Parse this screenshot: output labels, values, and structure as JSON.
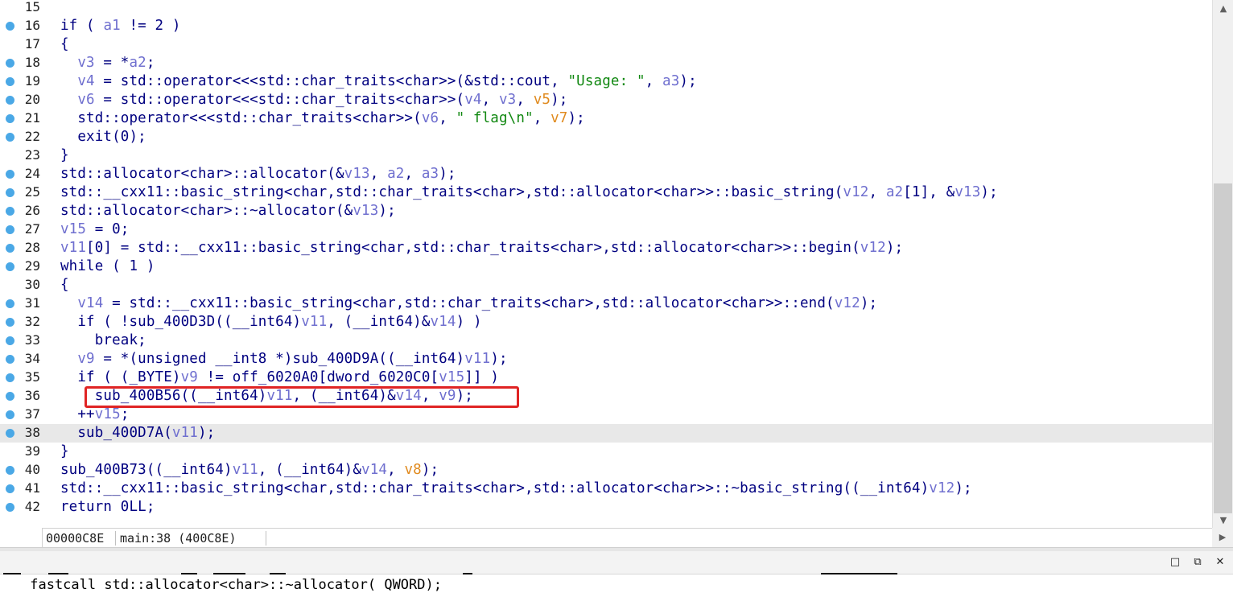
{
  "editor": {
    "lines": [
      {
        "num": "15",
        "bp": false,
        "html": ""
      },
      {
        "num": "16",
        "bp": true,
        "html": "if ( <span class=\"v\">a1</span> != 2 )"
      },
      {
        "num": "17",
        "bp": false,
        "html": "{"
      },
      {
        "num": "18",
        "bp": true,
        "html": "  <span class=\"v\">v3</span> = *<span class=\"v\">a2</span>;"
      },
      {
        "num": "19",
        "bp": true,
        "html": "  <span class=\"v\">v4</span> = std::operator&lt;&lt;&lt;std::char_traits&lt;char&gt;&gt;(&amp;std::cout, <span class=\"s\">\"Usage: \"</span>, <span class=\"v\">a3</span>);"
      },
      {
        "num": "20",
        "bp": true,
        "html": "  <span class=\"v\">v6</span> = std::operator&lt;&lt;&lt;std::char_traits&lt;char&gt;&gt;(<span class=\"v\">v4</span>, <span class=\"v\">v3</span>, <span class=\"o\">v5</span>);"
      },
      {
        "num": "21",
        "bp": true,
        "html": "  std::operator&lt;&lt;&lt;std::char_traits&lt;char&gt;&gt;(<span class=\"v\">v6</span>, <span class=\"s\">\" flag\\n\"</span>, <span class=\"o\">v7</span>);"
      },
      {
        "num": "22",
        "bp": true,
        "html": "  exit(0);"
      },
      {
        "num": "23",
        "bp": false,
        "html": "}"
      },
      {
        "num": "24",
        "bp": true,
        "html": "std::allocator&lt;char&gt;::allocator(&amp;<span class=\"v\">v13</span>, <span class=\"v\">a2</span>, <span class=\"v\">a3</span>);"
      },
      {
        "num": "25",
        "bp": true,
        "html": "std::__cxx11::basic_string&lt;char,std::char_traits&lt;char&gt;,std::allocator&lt;char&gt;&gt;::basic_string(<span class=\"v\">v12</span>, <span class=\"v\">a2</span>[1], &amp;<span class=\"v\">v13</span>);"
      },
      {
        "num": "26",
        "bp": true,
        "html": "std::allocator&lt;char&gt;::~allocator(&amp;<span class=\"v\">v13</span>);"
      },
      {
        "num": "27",
        "bp": true,
        "html": "<span class=\"v\">v15</span> = 0;"
      },
      {
        "num": "28",
        "bp": true,
        "html": "<span class=\"v\">v11</span>[0] = std::__cxx11::basic_string&lt;char,std::char_traits&lt;char&gt;,std::allocator&lt;char&gt;&gt;::begin(<span class=\"v\">v12</span>);"
      },
      {
        "num": "29",
        "bp": true,
        "html": "while ( 1 )"
      },
      {
        "num": "30",
        "bp": false,
        "html": "{"
      },
      {
        "num": "31",
        "bp": true,
        "html": "  <span class=\"v\">v14</span> = std::__cxx11::basic_string&lt;char,std::char_traits&lt;char&gt;,std::allocator&lt;char&gt;&gt;::end(<span class=\"v\">v12</span>);"
      },
      {
        "num": "32",
        "bp": true,
        "html": "  if ( !sub_400D3D((__int64)<span class=\"v\">v11</span>, (__int64)&amp;<span class=\"v\">v14</span>) )"
      },
      {
        "num": "33",
        "bp": true,
        "html": "    break;"
      },
      {
        "num": "34",
        "bp": true,
        "html": "  <span class=\"v\">v9</span> = *(unsigned __int8 *)sub_400D9A((__int64)<span class=\"v\">v11</span>);"
      },
      {
        "num": "35",
        "bp": true,
        "html": "  if ( (_BYTE)<span class=\"v\">v9</span> != off_6020A0[dword_6020C0[<span class=\"v\">v15</span>]] )"
      },
      {
        "num": "36",
        "bp": true,
        "html": "    sub_400B56((__int64)<span class=\"v\">v11</span>, (__int64)&amp;<span class=\"v\">v14</span>, <span class=\"v\">v9</span>);"
      },
      {
        "num": "37",
        "bp": true,
        "html": "  ++<span class=\"v\">v15</span>;"
      },
      {
        "num": "38",
        "bp": true,
        "html": "  sub_400D7A(<span class=\"v\">v11</span>);"
      },
      {
        "num": "39",
        "bp": false,
        "html": "}"
      },
      {
        "num": "40",
        "bp": true,
        "html": "sub_400B73((__int64)<span class=\"v\">v11</span>, (__int64)&amp;<span class=\"v\">v14</span>, <span class=\"o\">v8</span>);"
      },
      {
        "num": "41",
        "bp": true,
        "html": "std::__cxx11::basic_string&lt;char,std::char_traits&lt;char&gt;,std::allocator&lt;char&gt;&gt;::~basic_string((__int64)<span class=\"v\">v12</span>);"
      },
      {
        "num": "42",
        "bp": true,
        "html": "return 0LL;"
      }
    ],
    "current_line": "38",
    "highlighted_line": "36"
  },
  "status": {
    "address": "00000C8E",
    "location": "main:38 (400C8E)"
  },
  "bottom_pane": {
    "code": " fastcall std::allocator<char>::~allocator( QWORD);"
  },
  "colors": {
    "keyword": "#000080",
    "variable": "#6f6fcf",
    "argument_orange": "#e08a1e",
    "string": "#118811",
    "breakpoint_dot": "#4aa8e6",
    "highlight_box": "#e02424"
  },
  "icons": {
    "scroll_up": "chevron-up-icon",
    "scroll_down": "chevron-down-icon",
    "scroll_right": "chevron-right-icon",
    "maximize": "maximize-icon",
    "restore": "restore-icon",
    "close": "close-icon"
  }
}
